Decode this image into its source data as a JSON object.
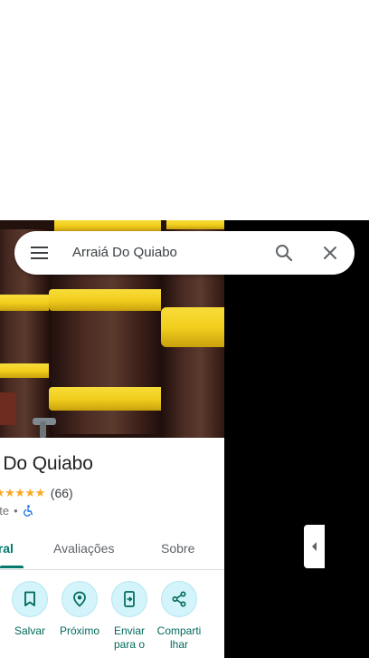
{
  "search": {
    "query": "Arraiá Do Quiabo"
  },
  "place": {
    "title": "á Do Quiabo",
    "stars": "★★★★★",
    "review_count": "(66)",
    "category": "nte",
    "separator": "•",
    "accessibility_icon": "wheelchair-icon"
  },
  "tabs": [
    {
      "label": "eral"
    },
    {
      "label": "Avaliações"
    },
    {
      "label": "Sobre"
    }
  ],
  "actions": [
    {
      "label": "Salvar",
      "icon": "bookmark-icon"
    },
    {
      "label": "Próximo",
      "icon": "nearby-icon"
    },
    {
      "label": "Enviar para o",
      "icon": "send-to-phone-icon"
    },
    {
      "label": "Comparti lhar",
      "icon": "share-icon"
    }
  ],
  "colors": {
    "accent": "#00796b",
    "action_bg": "#d2f4fa",
    "barrel_band": "#f2cf1d",
    "star": "#f9a825",
    "map_bg": "#000000"
  }
}
